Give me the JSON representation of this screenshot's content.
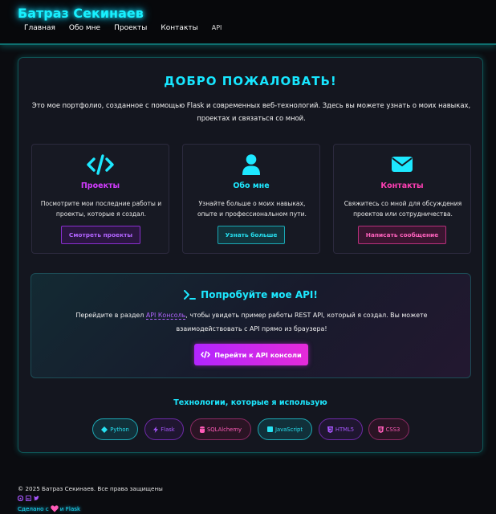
{
  "header": {
    "brand": "Батраз Секинаев",
    "nav": [
      "Главная",
      "Обо мне",
      "Проекты",
      "Контакты",
      "API"
    ]
  },
  "main": {
    "welcome": "ДОБРО ПОЖАЛОВАТЬ!",
    "intro": "Это мое портфолио, созданное с помощью Flask и современных веб-технологий. Здесь вы можете узнать о моих навыках, проектах и связаться со мной.",
    "cards": [
      {
        "icon": "code-icon",
        "title": "Проекты",
        "text": "Посмотрите мои последние работы и проекты, которые я создал.",
        "button": "Смотреть проекты"
      },
      {
        "icon": "user-icon",
        "title": "Обо мне",
        "text": "Узнайте больше о моих навыках, опыте и профессиональном пути.",
        "button": "Узнать больше"
      },
      {
        "icon": "envelope-icon",
        "title": "Контакты",
        "text": "Свяжитесь со мной для обсуждения проектов или сотрудничества.",
        "button": "Написать сообщение"
      }
    ],
    "api": {
      "title": "Попробуйте мое API!",
      "text_before": "Перейдите в раздел ",
      "link": "API Консоль",
      "text_after": ", чтобы увидеть пример работы REST API, который я создал. Вы можете взаимодействовать с API прямо из браузера!",
      "button": "Перейти к API консоли"
    },
    "tech_title": "Технологии, которые я использую",
    "tech": [
      "Python",
      "Flask",
      "SQLAlchemy",
      "JavaScript",
      "HTML5",
      "CSS3"
    ]
  },
  "footer": {
    "copyright": "© 2025 Батраз Секинаев. Все права защищены",
    "made_before": "Сделано с",
    "made_after": "и Flask"
  },
  "colors": {
    "cyan": "#1de8ff",
    "purple": "#b264ff",
    "pink": "#ff5cb8",
    "background": "#0b0c10"
  }
}
